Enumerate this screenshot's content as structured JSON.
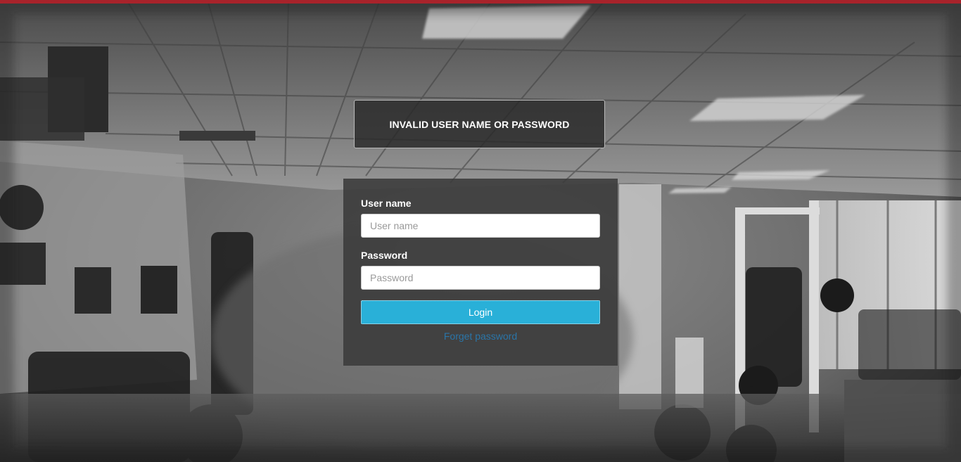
{
  "colors": {
    "brand_stripe": "#a8232b",
    "accent_button": "#29b0d8",
    "link": "#2a75a8"
  },
  "error": {
    "message": "INVALID USER NAME OR PASSWORD"
  },
  "login": {
    "username_label": "User name",
    "username_placeholder": "User name",
    "username_value": "",
    "password_label": "Password",
    "password_placeholder": "Password",
    "password_value": "",
    "login_button": "Login",
    "forgot_password": "Forget password"
  }
}
